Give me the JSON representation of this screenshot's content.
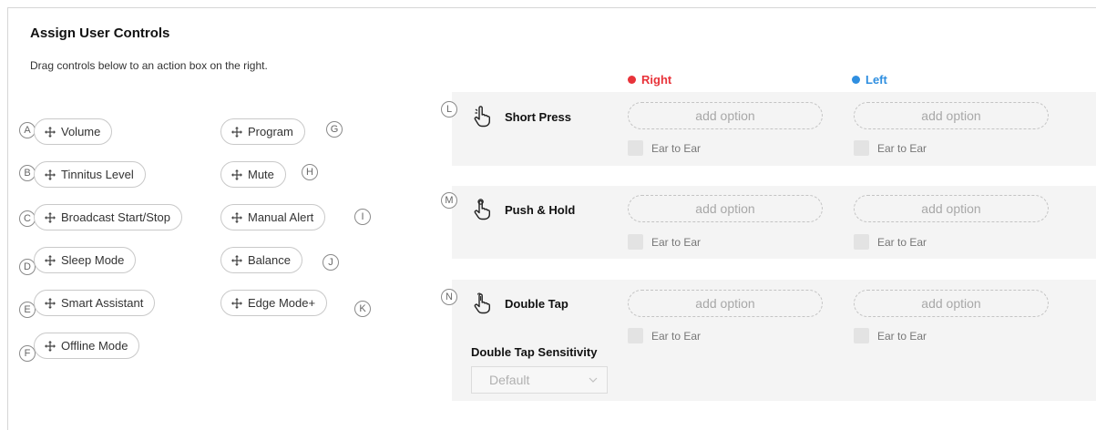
{
  "header": {
    "title": "Assign User Controls",
    "subtitle": "Drag controls below to an action box on the right."
  },
  "controls": [
    {
      "letter": "A",
      "label": "Volume"
    },
    {
      "letter": "B",
      "label": "Tinnitus Level"
    },
    {
      "letter": "C",
      "label": "Broadcast Start/Stop"
    },
    {
      "letter": "D",
      "label": "Sleep Mode"
    },
    {
      "letter": "E",
      "label": "Smart Assistant"
    },
    {
      "letter": "F",
      "label": "Offline Mode"
    },
    {
      "letter": "G",
      "label": "Program"
    },
    {
      "letter": "H",
      "label": "Mute"
    },
    {
      "letter": "I",
      "label": "Manual Alert"
    },
    {
      "letter": "J",
      "label": "Balance"
    },
    {
      "letter": "K",
      "label": "Edge Mode+"
    }
  ],
  "columns": {
    "right": {
      "label": "Right",
      "color": "#e8333a"
    },
    "left": {
      "label": "Left",
      "color": "#2f8fe0"
    }
  },
  "actions": [
    {
      "letter": "L",
      "label": "Short Press",
      "icon": "pointing-hand-icon",
      "placeholder": "add option",
      "ear": "Ear to Ear"
    },
    {
      "letter": "M",
      "label": "Push & Hold",
      "icon": "hold-hand-icon",
      "placeholder": "add option",
      "ear": "Ear to Ear"
    },
    {
      "letter": "N",
      "label": "Double Tap",
      "icon": "double-tap-hand-icon",
      "placeholder": "add option",
      "ear": "Ear to Ear"
    }
  ],
  "sensitivity": {
    "label": "Double Tap Sensitivity",
    "selected": "Default"
  }
}
